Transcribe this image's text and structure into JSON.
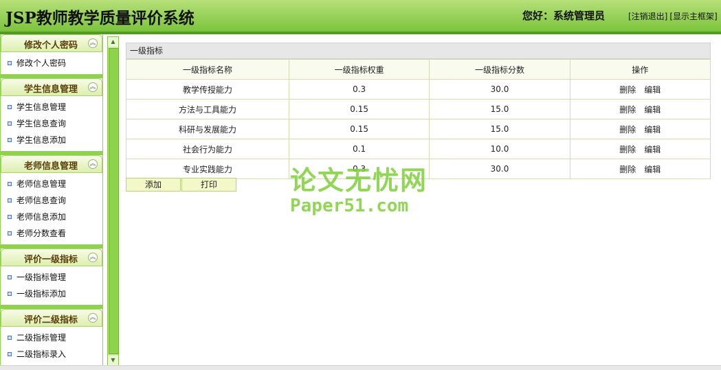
{
  "header": {
    "title": "JSP教师教学质量评价系统",
    "greeting": "您好：系统管理员",
    "logout": "[注销退出]",
    "show_frame": "[显示主框架]"
  },
  "sidebar": {
    "groups": [
      {
        "title": "修改个人密码",
        "items": [
          "修改个人密码"
        ]
      },
      {
        "title": "学生信息管理",
        "items": [
          "学生信息管理",
          "学生信息查询",
          "学生信息添加"
        ]
      },
      {
        "title": "老师信息管理",
        "items": [
          "老师信息管理",
          "老师信息查询",
          "老师信息添加",
          "老师分数查看"
        ]
      },
      {
        "title": "评价一级指标",
        "items": [
          "一级指标管理",
          "一级指标添加"
        ]
      },
      {
        "title": "评价二级指标",
        "items": [
          "二级指标管理",
          "二级指标录入"
        ]
      }
    ]
  },
  "main": {
    "table_title": "一级指标",
    "columns": [
      "一级指标名称",
      "一级指标权重",
      "一级指标分数",
      "操作"
    ],
    "rows": [
      {
        "name": "教学传授能力",
        "weight": "0.3",
        "score": "30.0"
      },
      {
        "name": "方法与工具能力",
        "weight": "0.15",
        "score": "15.0"
      },
      {
        "name": "科研与发展能力",
        "weight": "0.15",
        "score": "15.0"
      },
      {
        "name": "社会行为能力",
        "weight": "0.1",
        "score": "10.0"
      },
      {
        "name": "专业实践能力",
        "weight": "0.3",
        "score": "30.0"
      }
    ],
    "delete_label": "删除",
    "edit_label": "编辑",
    "add_button": "添加",
    "print_button": "打印"
  },
  "watermark": {
    "line1": "论文无忧网",
    "line2": "Paper51.com"
  },
  "colors": {
    "header_green": "#7cc33c",
    "sidebar_green": "#8fd24b",
    "group_title_brown": "#5a3e08"
  }
}
